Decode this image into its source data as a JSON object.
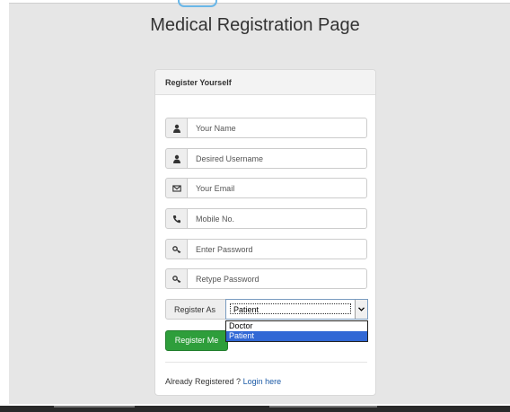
{
  "page": {
    "title": "Medical Registration Page"
  },
  "panel": {
    "heading": "Register Yourself"
  },
  "fields": [
    {
      "name": "name",
      "icon": "user-icon",
      "placeholder": "Your Name"
    },
    {
      "name": "username",
      "icon": "user-icon",
      "placeholder": "Desired Username"
    },
    {
      "name": "email",
      "icon": "envelope-icon",
      "placeholder": "Your Email"
    },
    {
      "name": "mobile",
      "icon": "phone-icon",
      "placeholder": "Mobile No."
    },
    {
      "name": "password",
      "icon": "key-icon",
      "placeholder": "Enter Password"
    },
    {
      "name": "retype-password",
      "icon": "key-icon",
      "placeholder": "Retype Password"
    }
  ],
  "role": {
    "label": "Register As",
    "selected": "Patient",
    "options": [
      "Doctor",
      "Patient"
    ]
  },
  "submit": {
    "label": "Register Me"
  },
  "footer": {
    "prompt": "Already Registered ?",
    "link": "Login here"
  },
  "colors": {
    "submit_bg": "#2e9e3b",
    "option_highlight": "#3168d5",
    "link": "#1b5aa6",
    "page_bg": "#e6e6e6"
  }
}
